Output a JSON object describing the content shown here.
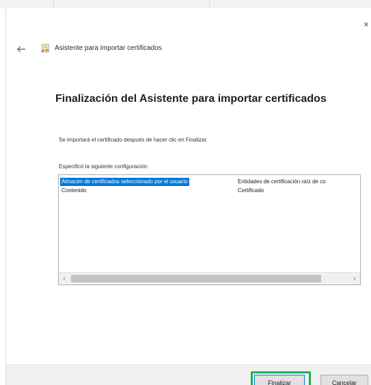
{
  "window": {
    "close_glyph": "×"
  },
  "header": {
    "back_icon": "back-arrow-icon",
    "app_icon": "certificate-wizard-icon",
    "title": "Asistente para importar certificados"
  },
  "main": {
    "heading": "Finalización del Asistente para importar certificados",
    "intro": "Se importará el certificado después de hacer clic en Finalizar.",
    "settings_label": "Especificó la siguiente configuración:",
    "settings": [
      {
        "name": "Almacén de certificados seleccionado por el usuario",
        "value": "Entidades de certificación raíz de co"
      },
      {
        "name": "Contenido",
        "value": "Certificado"
      }
    ],
    "scrollbar": {
      "left_glyph": "‹",
      "right_glyph": "›"
    }
  },
  "footer": {
    "finish_label": "Finalizar",
    "cancel_label": "Cancelar"
  },
  "colors": {
    "selection": "#0078d7",
    "highlight_outline": "#19b34a"
  }
}
